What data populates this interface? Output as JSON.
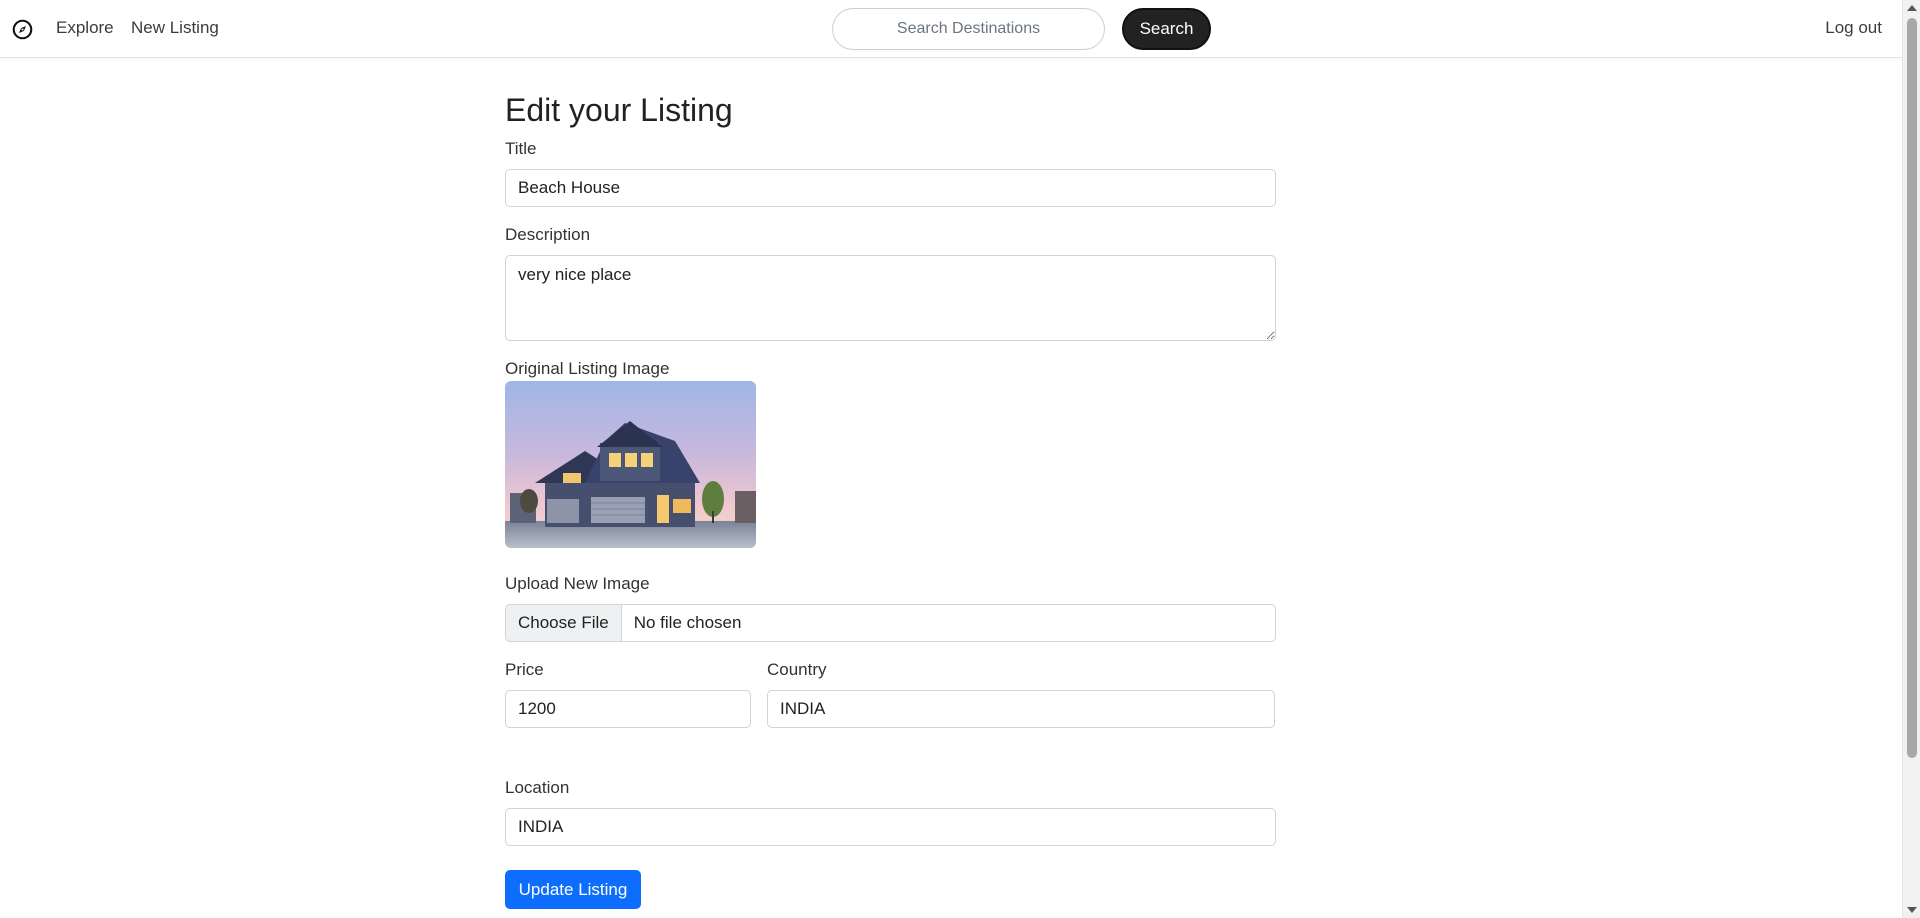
{
  "navbar": {
    "brand_icon": "compass-icon",
    "explore_label": "Explore",
    "new_listing_label": "New Listing",
    "search_placeholder": "Search Destinations",
    "search_button": "Search",
    "logout_label": "Log out"
  },
  "form": {
    "heading": "Edit your Listing",
    "title_label": "Title",
    "title_value": "Beach House",
    "description_label": "Description",
    "description_value": "very nice place",
    "original_image_label": "Original Listing Image",
    "image_description": "two-story house at dusk with pastel sky",
    "upload_label": "Upload New Image",
    "choose_file_label": "Choose File",
    "file_status": "No file chosen",
    "price_label": "Price",
    "price_value": "1200",
    "country_label": "Country",
    "country_value": "INDIA",
    "location_label": "Location",
    "location_value": "INDIA",
    "submit_label": "Update Listing"
  },
  "colors": {
    "primary": "#0d6efd",
    "search_button_bg": "#222222"
  }
}
